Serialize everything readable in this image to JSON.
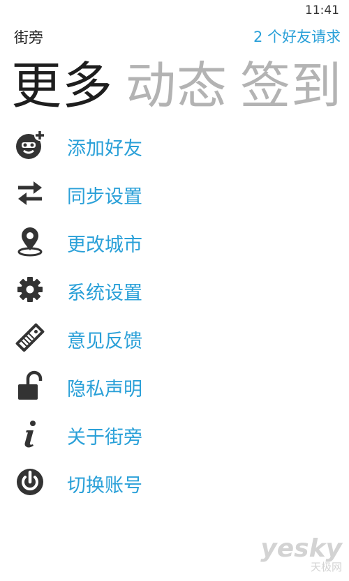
{
  "status_bar": {
    "time": "11:41"
  },
  "header": {
    "app_title": "街旁",
    "friend_requests": "2 个好友请求"
  },
  "pivot": {
    "tabs": [
      "更多",
      "动态",
      "签到"
    ],
    "active_index": 0
  },
  "menu": {
    "items": [
      {
        "label": "添加好友",
        "icon": "add-friend-icon"
      },
      {
        "label": "同步设置",
        "icon": "sync-arrows-icon"
      },
      {
        "label": "更改城市",
        "icon": "location-pin-icon"
      },
      {
        "label": "系统设置",
        "icon": "gear-icon"
      },
      {
        "label": "意见反馈",
        "icon": "tag-icon"
      },
      {
        "label": "隐私声明",
        "icon": "unlock-icon"
      },
      {
        "label": "关于街旁",
        "icon": "info-icon"
      },
      {
        "label": "切换账号",
        "icon": "power-icon"
      }
    ]
  },
  "watermark": {
    "main": "yesky",
    "sub": "天极网"
  },
  "colors": {
    "accent": "#2aa0d8",
    "icon": "#333333",
    "inactive_tab": "#b3b3b3"
  }
}
